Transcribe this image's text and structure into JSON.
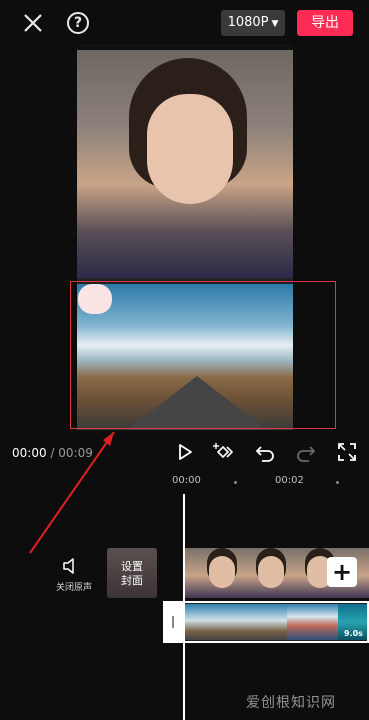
{
  "header": {
    "resolution": "1080P",
    "export_label": "导出"
  },
  "player": {
    "current_time": "00:00",
    "separator": " / ",
    "total_time": "00:09"
  },
  "ruler": {
    "ticks": [
      "00:00",
      "00:02"
    ]
  },
  "track": {
    "mute_label": "关闭原声",
    "cover_label_line1": "设置",
    "cover_label_line2": "封面",
    "overlay_duration": "9.0s"
  },
  "watermark": "爱创根知识网",
  "colors": {
    "accent": "#fe2c55",
    "selection": "#e0344a",
    "annotation_arrow": "#e02020"
  }
}
